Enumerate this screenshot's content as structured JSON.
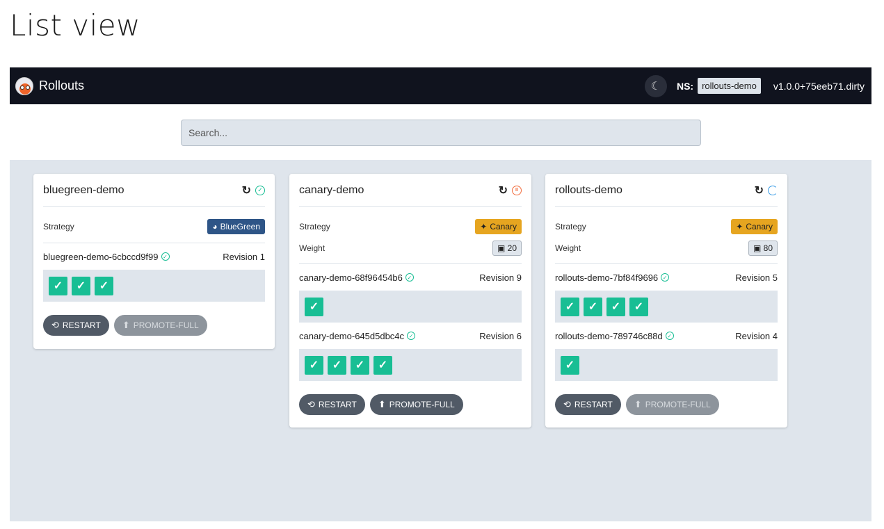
{
  "page": {
    "title": "List view"
  },
  "navbar": {
    "app_name": "Rollouts",
    "theme_icon": "moon-icon",
    "ns_label": "NS:",
    "namespace": "rollouts-demo",
    "version": "v1.0.0+75eeb71.dirty"
  },
  "search": {
    "placeholder": "Search..."
  },
  "labels": {
    "strategy": "Strategy",
    "weight": "Weight",
    "restart": "RESTART",
    "promote": "PROMOTE-FULL"
  },
  "colors": {
    "navbar": "#10131e",
    "healthy": "#18be94",
    "paused": "#f26c3c",
    "progressing": "#3e9ee6",
    "bluegreen": "#2e5587",
    "canary": "#e6a520"
  },
  "rollouts": [
    {
      "name": "bluegreen-demo",
      "status": "healthy",
      "strategy": "BlueGreen",
      "replicasets": [
        {
          "name": "bluegreen-demo-6cbccd9f99",
          "revision": "Revision 1",
          "pods": 3
        }
      ]
    },
    {
      "name": "canary-demo",
      "status": "paused",
      "strategy": "Canary",
      "weight": "20",
      "replicasets": [
        {
          "name": "canary-demo-68f96454b6",
          "revision": "Revision 9",
          "pods": 1
        },
        {
          "name": "canary-demo-645d5dbc4c",
          "revision": "Revision 6",
          "pods": 4
        }
      ]
    },
    {
      "name": "rollouts-demo",
      "status": "progressing",
      "strategy": "Canary",
      "weight": "80",
      "replicasets": [
        {
          "name": "rollouts-demo-7bf84f9696",
          "revision": "Revision 5",
          "pods": 4
        },
        {
          "name": "rollouts-demo-789746c88d",
          "revision": "Revision 4",
          "pods": 1
        }
      ]
    }
  ]
}
